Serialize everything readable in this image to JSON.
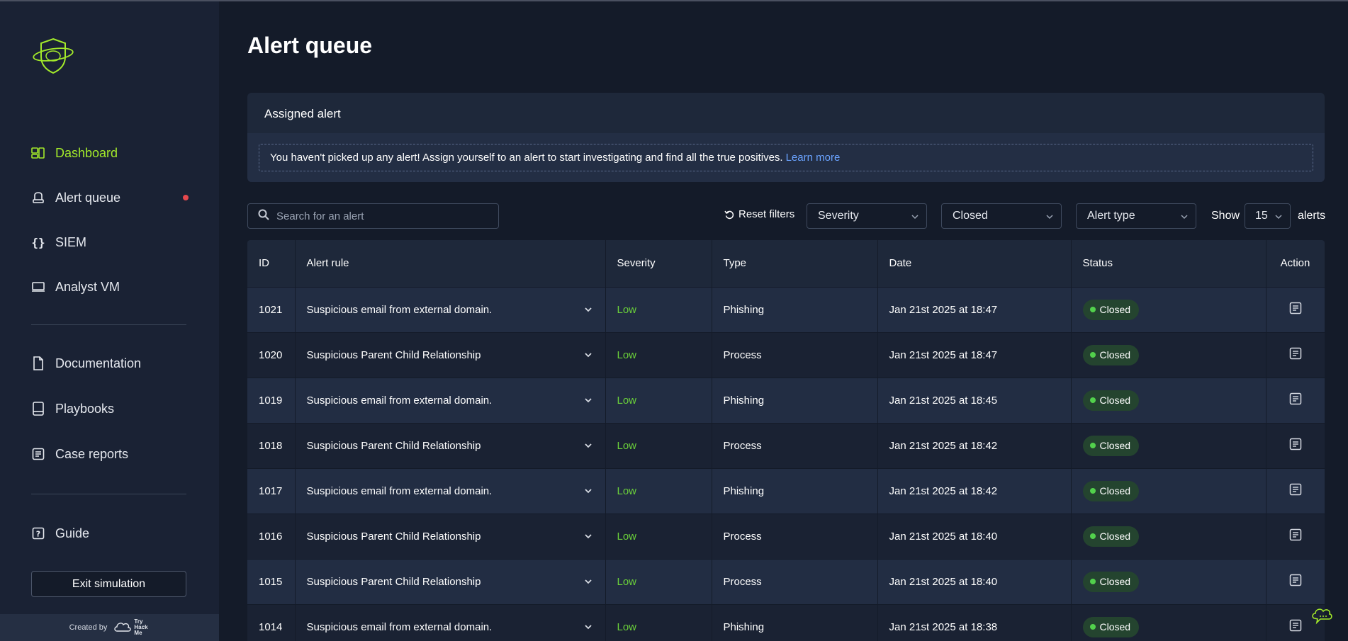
{
  "app": {
    "brand": "TryHackMe",
    "credit_label": "Created by",
    "credit_logo_text": "Try Hack Me"
  },
  "colors": {
    "accent": "#a3ea2a",
    "severity_low": "#6bd13a",
    "status_closed_bg": "#24442f",
    "link": "#6aa3ff",
    "notification_dot": "#e5484d"
  },
  "sidebar": {
    "items": [
      {
        "label": "Dashboard",
        "icon": "dashboard-icon",
        "active": true
      },
      {
        "label": "Alert queue",
        "icon": "alert-queue-icon",
        "active": false,
        "notification": true
      },
      {
        "label": "SIEM",
        "icon": "siem-braces-icon",
        "active": false
      },
      {
        "label": "Analyst VM",
        "icon": "monitor-icon",
        "active": false
      }
    ],
    "items2": [
      {
        "label": "Documentation",
        "icon": "document-icon"
      },
      {
        "label": "Playbooks",
        "icon": "book-icon"
      },
      {
        "label": "Case reports",
        "icon": "report-icon"
      }
    ],
    "guide": {
      "label": "Guide",
      "icon": "question-icon"
    },
    "exit_label": "Exit simulation"
  },
  "main": {
    "title": "Alert queue",
    "assigned": {
      "title": "Assigned alert",
      "message": "You haven't picked up any alert! Assign yourself to an alert to start investigating and find all the true positives.",
      "link_text": "Learn more"
    },
    "toolbar": {
      "search_placeholder": "Search for an alert",
      "reset_label": "Reset filters",
      "severity_select": "Severity",
      "status_select": "Closed",
      "type_select": "Alert type",
      "show_label": "Show",
      "show_value": "15",
      "alerts_label": "alerts"
    },
    "table": {
      "headers": [
        "ID",
        "Alert rule",
        "Severity",
        "Type",
        "Date",
        "Status",
        "Action"
      ],
      "rows": [
        {
          "id": "1021",
          "rule": "Suspicious email from external domain.",
          "severity": "Low",
          "type": "Phishing",
          "date": "Jan 21st 2025 at 18:47",
          "status": "Closed"
        },
        {
          "id": "1020",
          "rule": "Suspicious Parent Child Relationship",
          "severity": "Low",
          "type": "Process",
          "date": "Jan 21st 2025 at 18:47",
          "status": "Closed"
        },
        {
          "id": "1019",
          "rule": "Suspicious email from external domain.",
          "severity": "Low",
          "type": "Phishing",
          "date": "Jan 21st 2025 at 18:45",
          "status": "Closed"
        },
        {
          "id": "1018",
          "rule": "Suspicious Parent Child Relationship",
          "severity": "Low",
          "type": "Process",
          "date": "Jan 21st 2025 at 18:42",
          "status": "Closed"
        },
        {
          "id": "1017",
          "rule": "Suspicious email from external domain.",
          "severity": "Low",
          "type": "Phishing",
          "date": "Jan 21st 2025 at 18:42",
          "status": "Closed"
        },
        {
          "id": "1016",
          "rule": "Suspicious Parent Child Relationship",
          "severity": "Low",
          "type": "Process",
          "date": "Jan 21st 2025 at 18:40",
          "status": "Closed"
        },
        {
          "id": "1015",
          "rule": "Suspicious Parent Child Relationship",
          "severity": "Low",
          "type": "Process",
          "date": "Jan 21st 2025 at 18:40",
          "status": "Closed"
        },
        {
          "id": "1014",
          "rule": "Suspicious email from external domain.",
          "severity": "Low",
          "type": "Phishing",
          "date": "Jan 21st 2025 at 18:38",
          "status": "Closed"
        }
      ]
    }
  }
}
